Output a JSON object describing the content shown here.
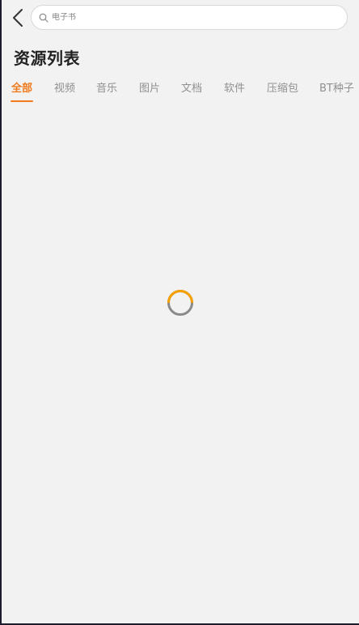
{
  "search": {
    "placeholder": "电子书"
  },
  "page": {
    "title": "资源列表"
  },
  "tabs": [
    {
      "label": "全部",
      "active": true
    },
    {
      "label": "视频",
      "active": false
    },
    {
      "label": "音乐",
      "active": false
    },
    {
      "label": "图片",
      "active": false
    },
    {
      "label": "文档",
      "active": false
    },
    {
      "label": "软件",
      "active": false
    },
    {
      "label": "压缩包",
      "active": false
    },
    {
      "label": "BT种子",
      "active": false
    }
  ],
  "colors": {
    "accent": "#f07a1c",
    "background": "#f2f2f2",
    "spinner_track": "#8a8a8a",
    "spinner_arc": "#f5a000"
  },
  "icons": {
    "back": "chevron-left-icon",
    "search": "search-icon",
    "loading": "loading-spinner-icon"
  }
}
